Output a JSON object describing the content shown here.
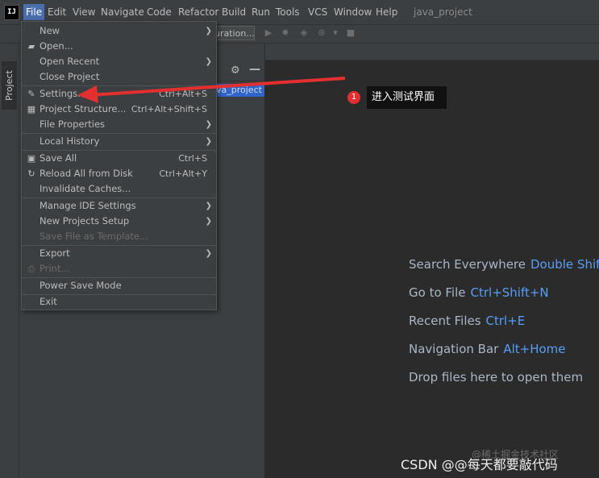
{
  "app": {
    "logo": "IJ",
    "project_title": "java_project"
  },
  "menubar": [
    {
      "label": "File",
      "active": true
    },
    {
      "label": "Edit"
    },
    {
      "label": "View"
    },
    {
      "label": "Navigate"
    },
    {
      "label": "Code"
    },
    {
      "label": "Refactor"
    },
    {
      "label": "Build"
    },
    {
      "label": "Run"
    },
    {
      "label": "Tools"
    },
    {
      "label": "VCS"
    },
    {
      "label": "Window"
    },
    {
      "label": "Help"
    }
  ],
  "toolbar": {
    "run_config": "uration..."
  },
  "side_stripe": {
    "project_tab": "Project"
  },
  "project_panel": {
    "tree_root": "va_project"
  },
  "file_menu": {
    "items": [
      {
        "label": "New",
        "submenu": true
      },
      {
        "label": "Open...",
        "icon": "folder-open-icon"
      },
      {
        "label": "Open Recent",
        "submenu": true
      },
      {
        "label": "Close Project"
      },
      {
        "label": "Settings...",
        "shortcut": "Ctrl+Alt+S",
        "icon": "wrench-icon"
      },
      {
        "label": "Project Structure...",
        "shortcut": "Ctrl+Alt+Shift+S",
        "icon": "project-structure-icon"
      },
      {
        "label": "File Properties",
        "submenu": true
      },
      {
        "label": "Local History",
        "submenu": true
      },
      {
        "label": "Save All",
        "shortcut": "Ctrl+S",
        "icon": "save-icon"
      },
      {
        "label": "Reload All from Disk",
        "shortcut": "Ctrl+Alt+Y",
        "icon": "reload-icon"
      },
      {
        "label": "Invalidate Caches..."
      },
      {
        "label": "Manage IDE Settings",
        "submenu": true
      },
      {
        "label": "New Projects Setup",
        "submenu": true
      },
      {
        "label": "Save File as Template...",
        "disabled": true
      },
      {
        "label": "Export",
        "submenu": true
      },
      {
        "label": "Print...",
        "disabled": true,
        "icon": "print-icon"
      },
      {
        "label": "Power Save Mode"
      },
      {
        "label": "Exit"
      }
    ]
  },
  "editor_hints": [
    {
      "text": "Search Everywhere",
      "key": "Double Shift"
    },
    {
      "text": "Go to File",
      "key": "Ctrl+Shift+N"
    },
    {
      "text": "Recent Files",
      "key": "Ctrl+E"
    },
    {
      "text": "Navigation Bar",
      "key": "Alt+Home"
    },
    {
      "text": "Drop files here to open them",
      "key": ""
    }
  ],
  "annotation": {
    "step_number": "1",
    "callout_text": "进入测试界面"
  },
  "watermark": {
    "text": "CSDN @@每天都要敲代码",
    "faint_text": "@稀土掘金技术社区"
  },
  "colors": {
    "menu_bg": "#3c3f41",
    "editor_bg": "#2b2b2b",
    "selection": "#4b6eaf",
    "hint_key": "#589df6",
    "annotation_red": "#e32f2f"
  }
}
